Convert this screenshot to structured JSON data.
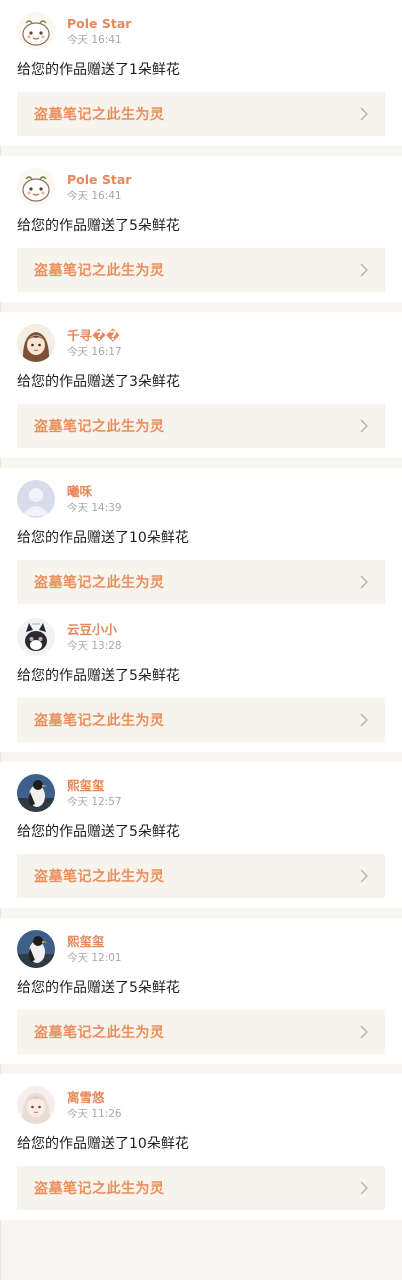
{
  "colors": {
    "name": "#e8885a",
    "work_title": "#ec8f5e",
    "work_bg": "#f6f4ec",
    "time": "#a8a8a8",
    "page_bg": "#f7f6f3"
  },
  "items": [
    {
      "avatar": "cartoon-bird-avatar",
      "name": "Pole Star",
      "time": "今天 16:41",
      "message": "给您的作品赠送了1朵鲜花",
      "work": "盗墓笔记之此生为灵"
    },
    {
      "avatar": "cartoon-bird-avatar",
      "name": "Pole Star",
      "time": "今天 16:41",
      "message": "给您的作品赠送了5朵鲜花",
      "work": "盗墓笔记之此生为灵"
    },
    {
      "avatar": "anime-girl-avatar",
      "name": "千寻��",
      "time": "今天 16:17",
      "message": "给您的作品赠送了3朵鲜花",
      "work": "盗墓笔记之此生为灵"
    },
    {
      "avatar": "default-user-avatar",
      "name": "曦咊",
      "time": "今天 14:39",
      "message": "给您的作品赠送了10朵鲜花",
      "work": "盗墓笔记之此生为灵"
    },
    {
      "avatar": "cat-avatar",
      "name": "云豆小小",
      "time": "今天 13:28",
      "message": "给您的作品赠送了5朵鲜花",
      "work": "盗墓笔记之此生为灵"
    },
    {
      "avatar": "bird-photo-avatar",
      "name": "熙玺玺",
      "time": "今天 12:57",
      "message": "给您的作品赠送了5朵鲜花",
      "work": "盗墓笔记之此生为灵"
    },
    {
      "avatar": "bird-photo-avatar",
      "name": "熙玺玺",
      "time": "今天 12:01",
      "message": "给您的作品赠送了5朵鲜花",
      "work": "盗墓笔记之此生为灵"
    },
    {
      "avatar": "anime-girl-avatar-2",
      "name": "离雪悠",
      "time": "今天 11:26",
      "message": "给您的作品赠送了10朵鲜花",
      "work": "盗墓笔记之此生为灵"
    }
  ]
}
